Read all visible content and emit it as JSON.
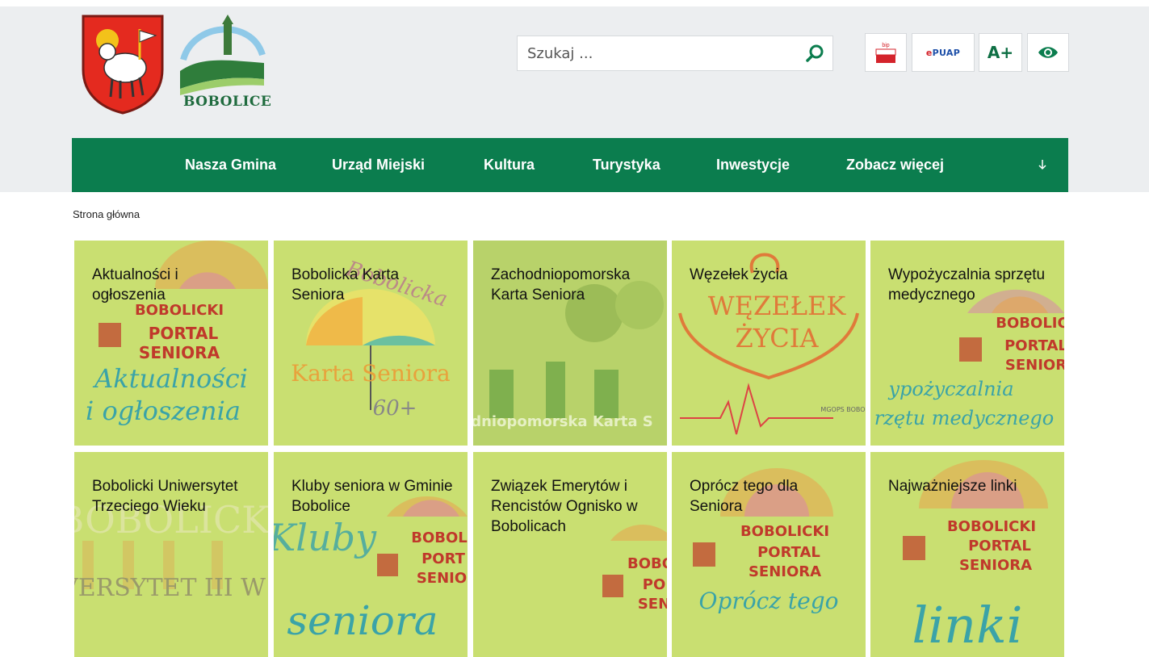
{
  "search": {
    "placeholder": "Szukaj ..."
  },
  "header": {
    "town_logo_text": "BOBOLICE",
    "bip_label": "bip",
    "epuap_label_e": "e",
    "epuap_label_rest": "PUAP",
    "font_size_label": "A+"
  },
  "nav": {
    "items": [
      {
        "label": "Nasza Gmina"
      },
      {
        "label": "Urząd Miejski"
      },
      {
        "label": "Kultura"
      },
      {
        "label": "Turystyka"
      },
      {
        "label": "Inwestycje"
      },
      {
        "label": "Zobacz więcej"
      }
    ]
  },
  "breadcrumb": {
    "home": "Strona główna"
  },
  "tiles": [
    {
      "title": "Aktualności i ogłoszenia",
      "art_lines": [
        "BOBOLICKI",
        "PORTAL",
        "SENIORA",
        "Aktualności",
        "i ogłoszenia"
      ]
    },
    {
      "title": "Bobolicka Karta Seniora",
      "art_lines": [
        "Bobolicka",
        "Karta Seniora",
        "60+"
      ]
    },
    {
      "title": "Zachodniopomorska Karta Seniora",
      "art_lines": [
        "dniopomorska Karta S"
      ]
    },
    {
      "title": "Węzełek życia",
      "art_lines": [
        "WĘZEŁEK",
        "ŻYCIA",
        "MGOPS BOBO"
      ]
    },
    {
      "title": "Wypożyczalnia sprzętu medycznego",
      "art_lines": [
        "BOBOLIC",
        "PORTAL",
        "SENIOR",
        "ypożyczalnia",
        "rzętu medycznego"
      ]
    },
    {
      "title": "Bobolicki Uniwersytet Trzeciego Wieku",
      "art_lines": [
        "BOBOLICK",
        "VERSYTET III W"
      ]
    },
    {
      "title": "Kluby seniora w Gminie Bobolice",
      "art_lines": [
        "Kluby",
        "BOBOL",
        "PORT",
        "SENIO",
        "seniora"
      ]
    },
    {
      "title": "Związek Emerytów i Rencistów Ognisko w Bobolicach",
      "art_lines": [
        "BOBO",
        "PO",
        "SEN"
      ]
    },
    {
      "title": "Oprócz tego dla Seniora",
      "art_lines": [
        "BOBOLICKI",
        "PORTAL",
        "SENIORA",
        "Oprócz tego"
      ]
    },
    {
      "title": "Najważniejsze linki",
      "art_lines": [
        "BOBOLICKI",
        "PORTAL",
        "SENIORA",
        "linki"
      ]
    }
  ],
  "colors": {
    "nav_green": "#0b7d4e",
    "tile_green": "#c9df71",
    "header_bg": "#eceef0"
  }
}
